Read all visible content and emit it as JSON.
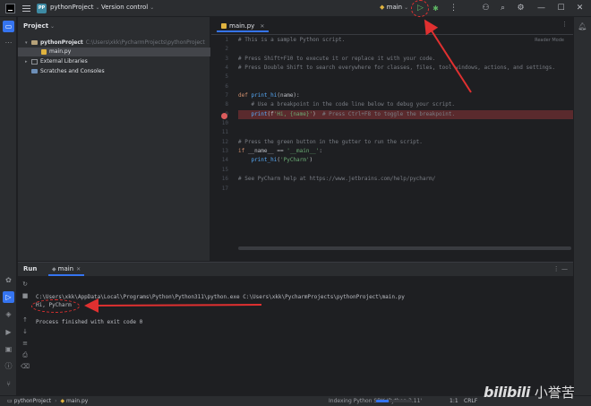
{
  "titlebar": {
    "project_badge": "PP",
    "project_name": "pythonProject",
    "version_control": "Version control",
    "run_config": "main"
  },
  "project_panel": {
    "title": "Project",
    "tree": [
      {
        "label": "pythonProject",
        "path": "C:\\Users\\xkk\\PycharmProjects\\pythonProject"
      },
      {
        "label": "main.py"
      },
      {
        "label": "External Libraries"
      },
      {
        "label": "Scratches and Consoles"
      }
    ]
  },
  "editor": {
    "tab_label": "main.py",
    "reader_mode": "Reader Mode",
    "lines": [
      "# This is a sample Python script.",
      "",
      "# Press Shift+F10 to execute it or replace it with your code.",
      "# Press Double Shift to search everywhere for classes, files, tool windows, actions, and settings.",
      "",
      "",
      "def print_hi(name):",
      "    # Use a breakpoint in the code line below to debug your script.",
      "    print(f'Hi, {name}')  # Press Ctrl+F8 to toggle the breakpoint.",
      "",
      "",
      "# Press the green button in the gutter to run the script.",
      "if __name__ == '__main__':",
      "    print_hi('PyCharm')",
      "",
      "# See PyCharm help at https://www.jetbrains.com/help/pycharm/",
      ""
    ],
    "line_numbers": [
      "1",
      "2",
      "3",
      "4",
      "5",
      "6",
      "7",
      "8",
      "9",
      "10",
      "11",
      "12",
      "13",
      "14",
      "15",
      "16",
      "17"
    ],
    "breakpoint_line": 9
  },
  "run_panel": {
    "title": "Run",
    "tab_label": "main",
    "console": [
      "C:\\Users\\xkk\\AppData\\Local\\Programs\\Python\\Python311\\python.exe C:\\Users\\xkk\\PycharmProjects\\pythonProject\\main.py",
      "Hi, PyCharm",
      "",
      "Process finished with exit code 0"
    ]
  },
  "statusbar": {
    "crumb_project": "pythonProject",
    "crumb_file": "main.py",
    "indexing": "Indexing Python SDK 'Python 3.11'",
    "indexing_progress": 0.35,
    "position": "1:1",
    "line_separator": "CRLF"
  },
  "watermark": {
    "logo": "bilibili",
    "name": "小誉苦"
  },
  "colors": {
    "accent": "#3574f0",
    "run_green": "#5fb865",
    "annotation_red": "#e03030",
    "breakpoint": "#db5c5c"
  }
}
